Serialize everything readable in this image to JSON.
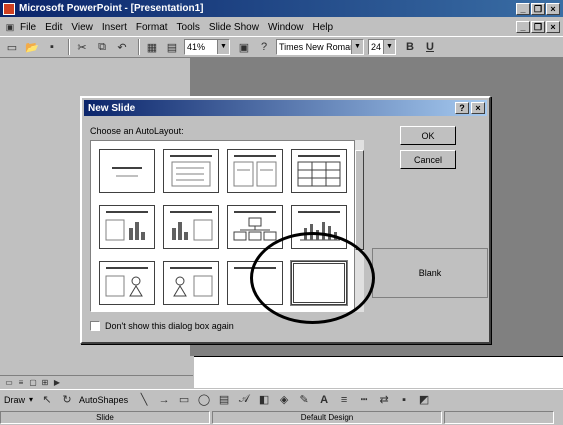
{
  "window": {
    "title": "Microsoft PowerPoint - [Presentation1]"
  },
  "menu": [
    {
      "label": "File"
    },
    {
      "label": "Edit"
    },
    {
      "label": "View"
    },
    {
      "label": "Insert"
    },
    {
      "label": "Format"
    },
    {
      "label": "Tools"
    },
    {
      "label": "Slide Show"
    },
    {
      "label": "Window"
    },
    {
      "label": "Help"
    }
  ],
  "toolbar": {
    "zoom": "41%",
    "font": "Times New Roman",
    "size": "24",
    "bold": "B",
    "underline": "U"
  },
  "dialog": {
    "title": "New Slide",
    "help": "?",
    "close": "×",
    "choose_label": "Choose an AutoLayout:",
    "ok": "OK",
    "cancel": "Cancel",
    "preview_label": "Blank",
    "dont_show": "Don't show this dialog box again"
  },
  "draw_toolbar": {
    "draw": "Draw",
    "autoshapes": "AutoShapes"
  },
  "status": {
    "slide": "Slide",
    "design": "Default Design"
  }
}
